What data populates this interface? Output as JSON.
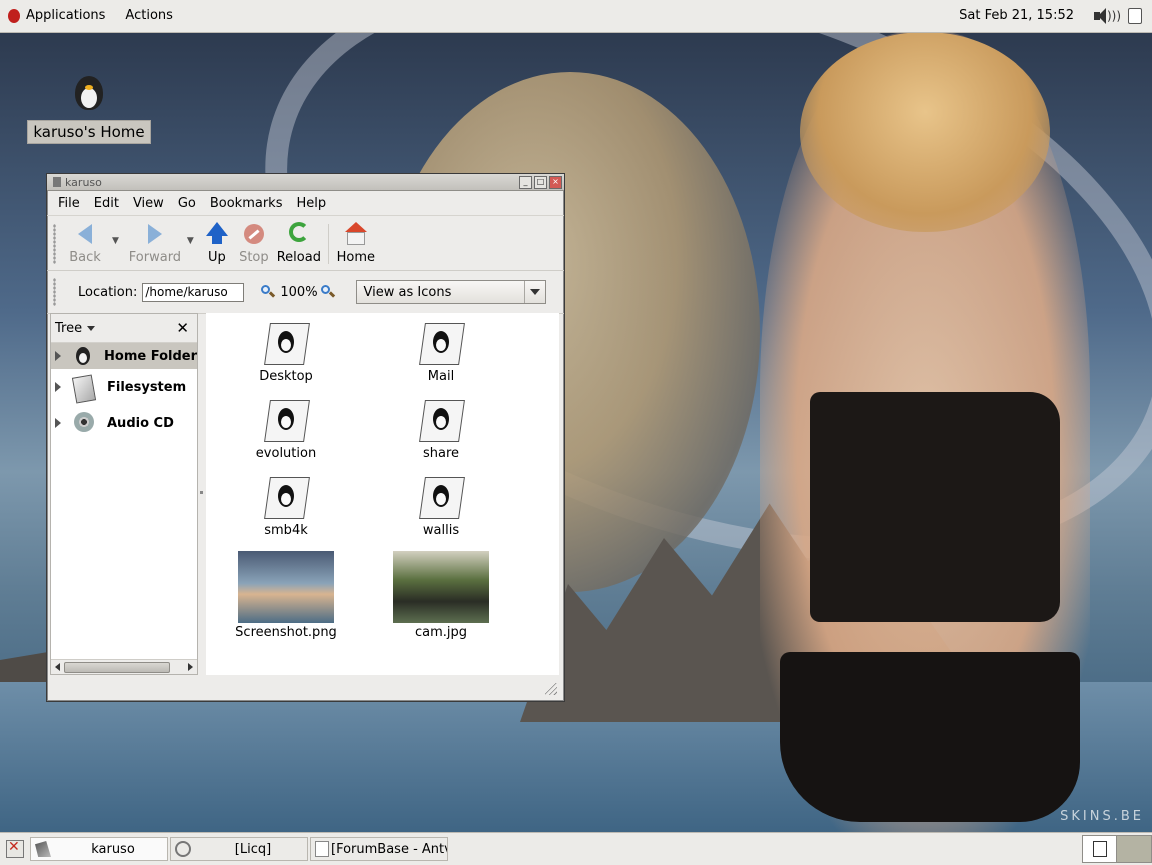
{
  "top_panel": {
    "applications_label": "Applications",
    "actions_label": "Actions",
    "clock": "Sat Feb 21, 15:52"
  },
  "desktop": {
    "home_icon_label": "karuso's Home",
    "watermark": "SKINS.BE"
  },
  "window": {
    "title": "karuso",
    "menu": {
      "file": "File",
      "edit": "Edit",
      "view": "View",
      "go": "Go",
      "bookmarks": "Bookmarks",
      "help": "Help"
    },
    "toolbar": {
      "back": "Back",
      "forward": "Forward",
      "up": "Up",
      "stop": "Stop",
      "reload": "Reload",
      "home": "Home"
    },
    "location": {
      "label": "Location:",
      "value": "/home/karuso",
      "zoom": "100%",
      "view_mode": "View as Icons"
    },
    "sidebar": {
      "title": "Tree",
      "items": [
        {
          "label": "Home Folder",
          "icon": "tux-icon"
        },
        {
          "label": "Filesystem",
          "icon": "filesystem-icon"
        },
        {
          "label": "Audio CD",
          "icon": "cd-icon"
        }
      ]
    },
    "files": [
      {
        "name": "Desktop",
        "type": "folder"
      },
      {
        "name": "Mail",
        "type": "folder"
      },
      {
        "name": "evolution",
        "type": "folder"
      },
      {
        "name": "share",
        "type": "folder"
      },
      {
        "name": "smb4k",
        "type": "folder"
      },
      {
        "name": "wallis",
        "type": "folder"
      },
      {
        "name": "Screenshot.png",
        "type": "image"
      },
      {
        "name": "cam.jpg",
        "type": "image"
      }
    ]
  },
  "taskbar": {
    "tasks": [
      {
        "label": "karuso",
        "icon": "nautilus-icon"
      },
      {
        "label": "[Licq]",
        "icon": "licq-icon"
      },
      {
        "label": "[ForumBase - Antv",
        "icon": "window-icon"
      }
    ]
  },
  "colors": {
    "panel_bg": "#ecebe8",
    "selection": "#c9c6bf",
    "up_arrow": "#1f62c7",
    "reload": "#3da43d",
    "home_roof": "#d9472b"
  }
}
